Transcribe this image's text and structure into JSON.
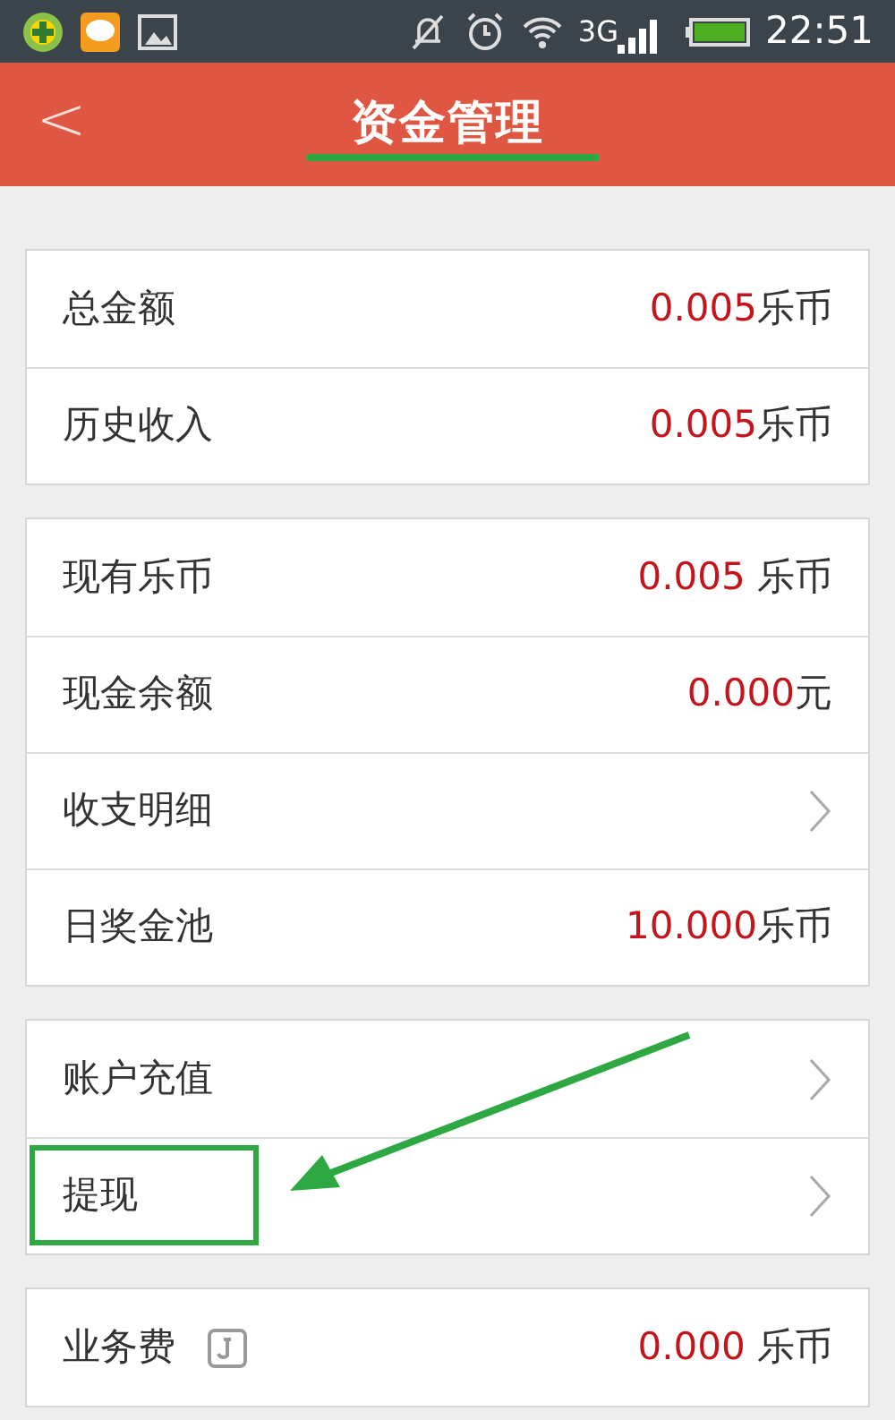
{
  "status_bar": {
    "network": "3G",
    "time": "22:51"
  },
  "header": {
    "back": "<",
    "title": "资金管理"
  },
  "groups": [
    {
      "rows": [
        {
          "kind": "amount",
          "label": "总金额",
          "value": "0.005",
          "unit": "乐币"
        },
        {
          "kind": "amount",
          "label": "历史收入",
          "value": "0.005",
          "unit": "乐币"
        }
      ]
    },
    {
      "rows": [
        {
          "kind": "amount",
          "label": "现有乐币",
          "value": "0.005 ",
          "unit": "乐币"
        },
        {
          "kind": "amount",
          "label": "现金余额",
          "value": "0.000",
          "unit": "元"
        },
        {
          "kind": "link",
          "label": "收支明细"
        },
        {
          "kind": "amount",
          "label": "日奖金池",
          "value": "10.000",
          "unit": "乐币"
        }
      ]
    },
    {
      "rows": [
        {
          "kind": "link",
          "label": "账户充值"
        },
        {
          "kind": "link",
          "label": "提现"
        }
      ]
    },
    {
      "rows": [
        {
          "kind": "amount",
          "label": "业务费",
          "info": true,
          "value": "0.000 ",
          "unit": "乐币"
        }
      ]
    }
  ]
}
